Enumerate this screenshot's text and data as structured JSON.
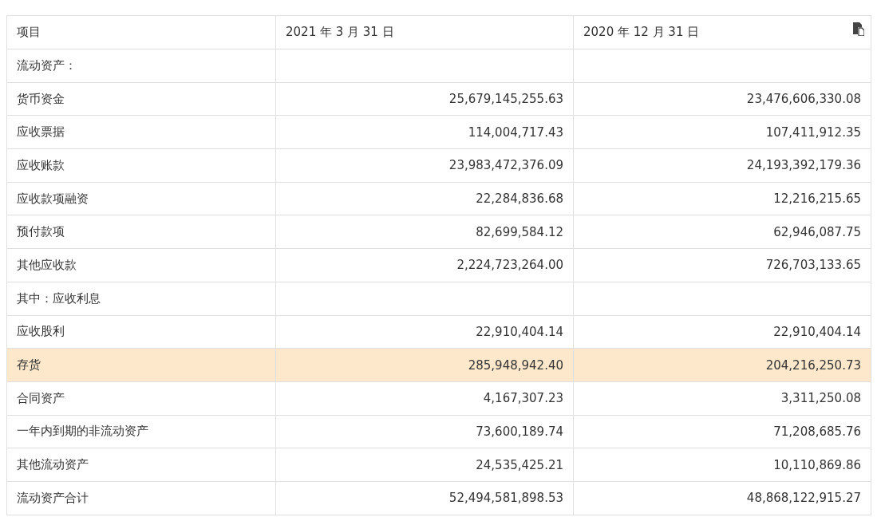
{
  "table": {
    "columns": [
      "项目",
      "2021 年 3 月 31 日",
      "2020 年 12 月 31 日"
    ],
    "rows": [
      {
        "item": "流动资产：",
        "highlighted": false
      },
      {
        "item": "货币资金",
        "values": [
          "25,679,145,255.63",
          "23,476,606,330.08"
        ],
        "highlighted": false
      },
      {
        "item": "应收票据",
        "values": [
          "114,004,717.43",
          "107,411,912.35"
        ],
        "highlighted": false
      },
      {
        "item": "应收账款",
        "values": [
          "23,983,472,376.09",
          "24,193,392,179.36"
        ],
        "highlighted": false
      },
      {
        "item": "应收款项融资",
        "values": [
          "22,284,836.68",
          "12,216,215.65"
        ],
        "highlighted": false
      },
      {
        "item": "预付款项",
        "values": [
          "82,699,584.12",
          "62,946,087.75"
        ],
        "highlighted": false
      },
      {
        "item": "其他应收款",
        "values": [
          "2,224,723,264.00",
          "726,703,133.65"
        ],
        "highlighted": false
      },
      {
        "item": "其中：应收利息",
        "highlighted": false
      },
      {
        "item": "应收股利",
        "values": [
          "22,910,404.14",
          "22,910,404.14"
        ],
        "highlighted": false
      },
      {
        "item": "存货",
        "values": [
          "285,948,942.40",
          "204,216,250.73"
        ],
        "highlighted": true
      },
      {
        "item": "合同资产",
        "values": [
          "4,167,307.23",
          "3,311,250.08"
        ],
        "highlighted": false
      },
      {
        "item": "一年内到期的非流动资产",
        "values": [
          "73,600,189.74",
          "71,208,685.76"
        ],
        "highlighted": false
      },
      {
        "item": "其他流动资产",
        "values": [
          "24,535,425.21",
          "10,110,869.86"
        ],
        "highlighted": false
      },
      {
        "item": "流动资产合计",
        "values": [
          "52,494,581,898.53",
          "48,868,122,915.27"
        ],
        "highlighted": false
      }
    ]
  }
}
